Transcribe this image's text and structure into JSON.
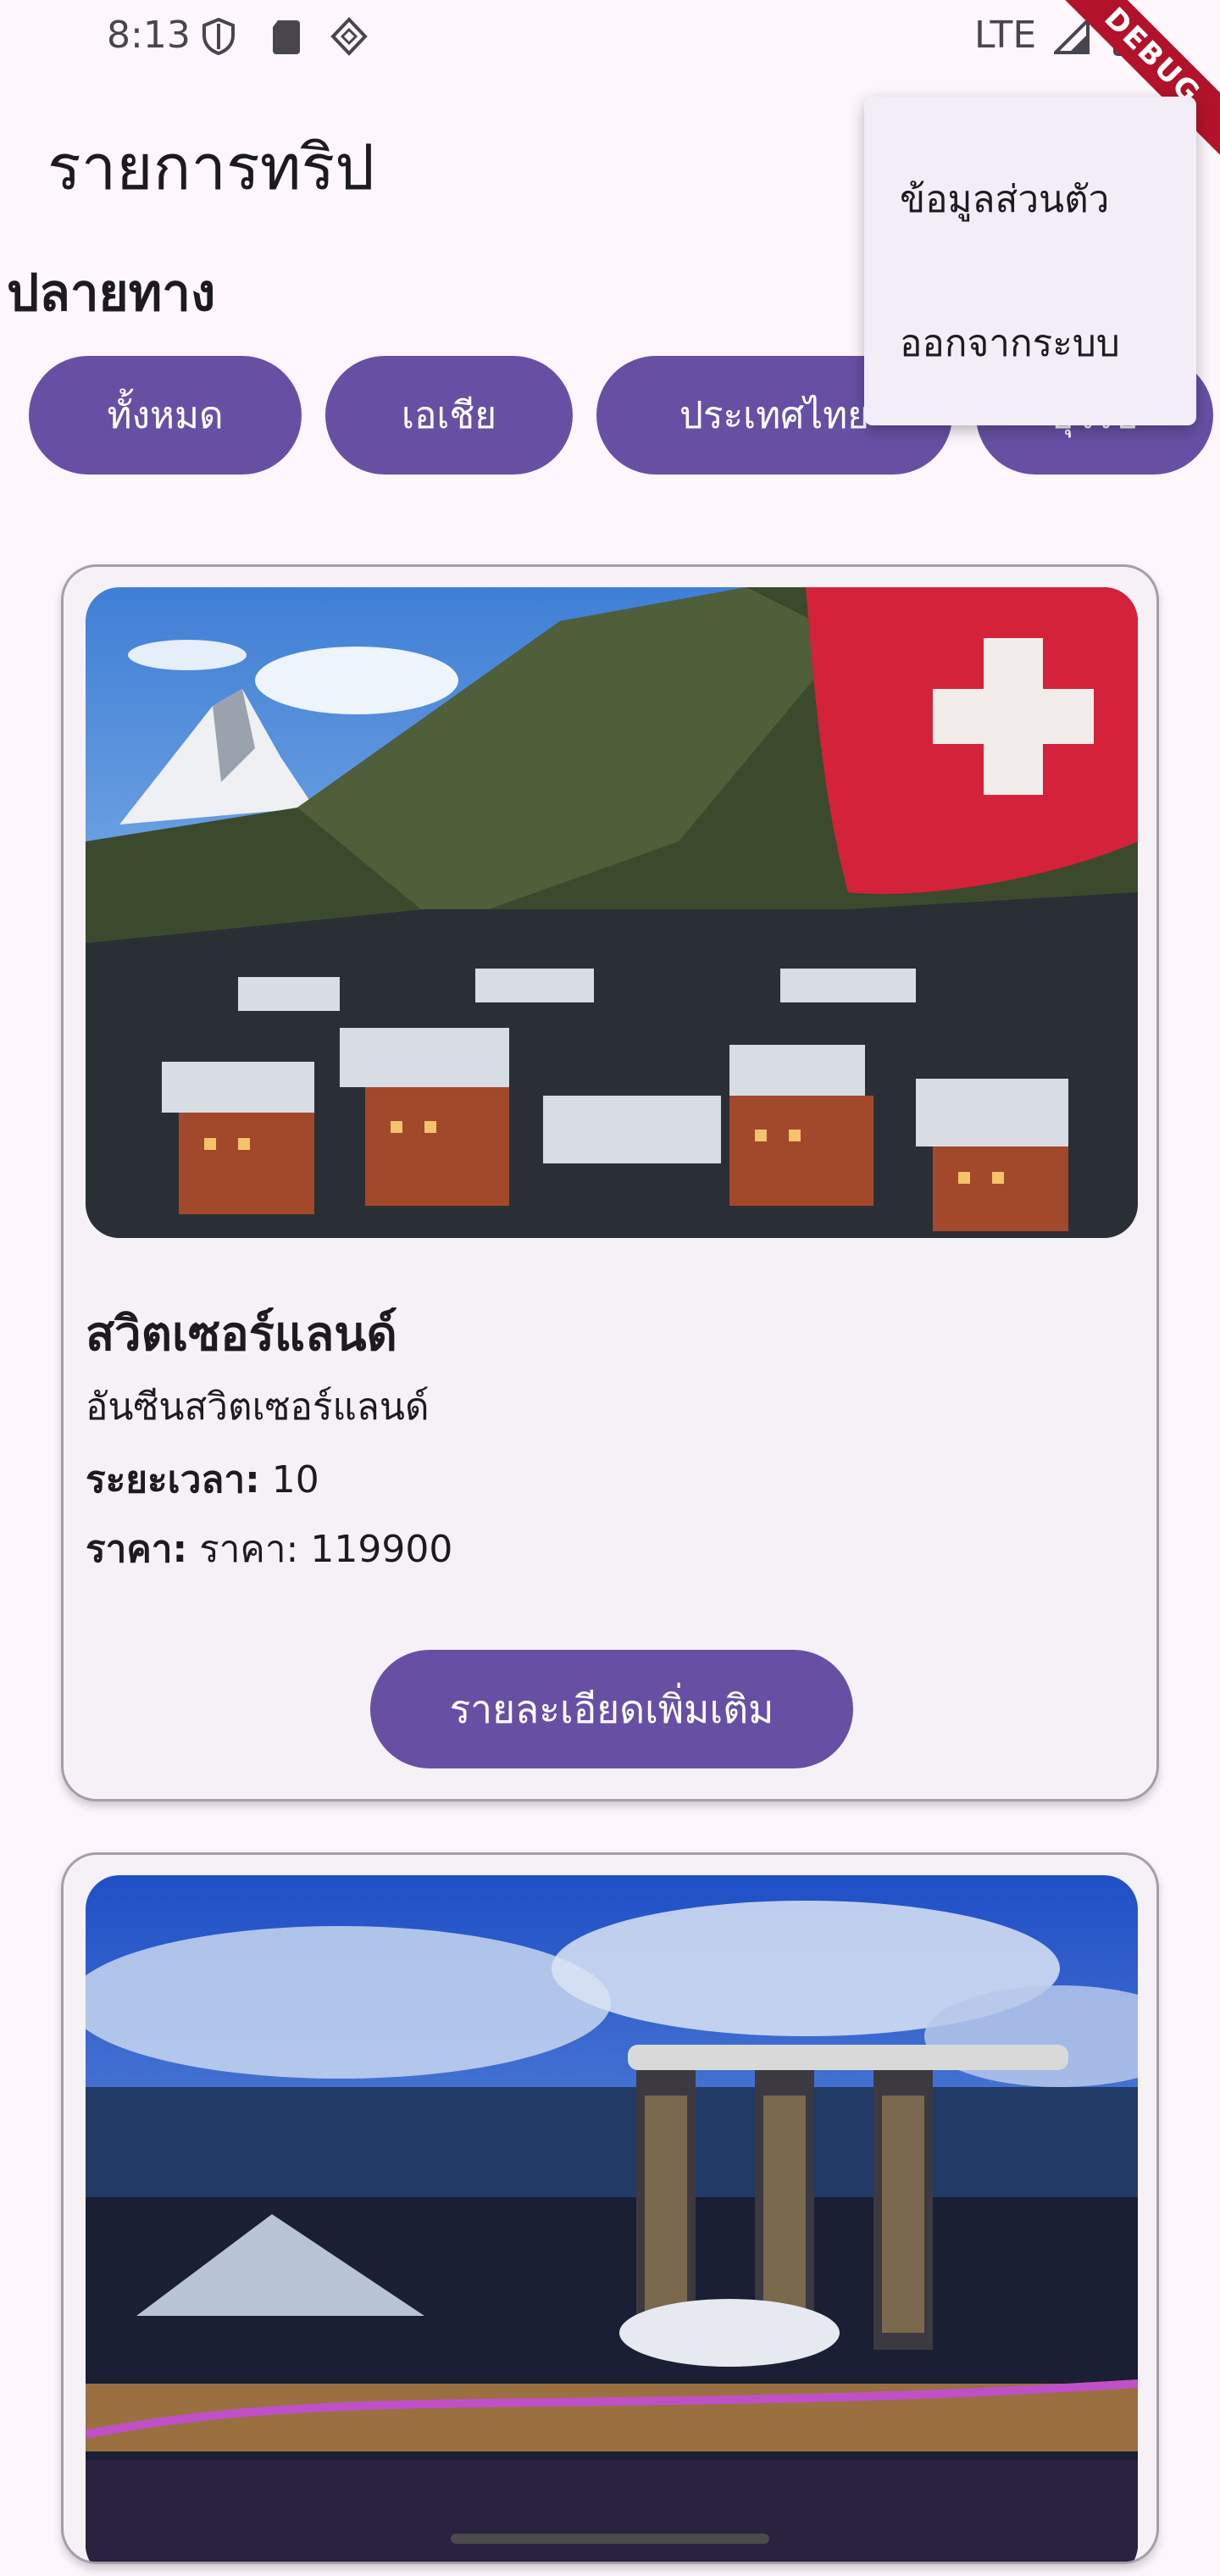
{
  "status_bar": {
    "time": "8:13",
    "network": "LTE",
    "debug_label": "DEBUG"
  },
  "app_bar": {
    "title": "รายการทริป"
  },
  "section": {
    "label": "ปลายทาง"
  },
  "filters": {
    "chips": [
      "ทั้งหมด",
      "เอเชีย",
      "ประเทศไทย",
      "ยุโรป"
    ]
  },
  "menu": {
    "items": [
      "ข้อมูลส่วนตัว",
      "ออกจากระบบ"
    ]
  },
  "trips": [
    {
      "name": "สวิตเซอร์แลนด์",
      "subtitle": "อันซีนสวิตเซอร์แลนด์",
      "duration_label": "ระยะเวลา:",
      "duration_value": "10",
      "price_label": "ราคา:",
      "price_value": "ราคา: 119900",
      "button_label": "รายละเอียดเพิ่มเติม",
      "image": "switzerland-zermatt-photo"
    },
    {
      "image": "singapore-marina-bay-photo"
    }
  ],
  "colors": {
    "primary": "#6750a4",
    "background": "#fdf7fd",
    "card": "#f6f1f7",
    "menu": "#f3edf7",
    "debug": "#b2132a"
  }
}
